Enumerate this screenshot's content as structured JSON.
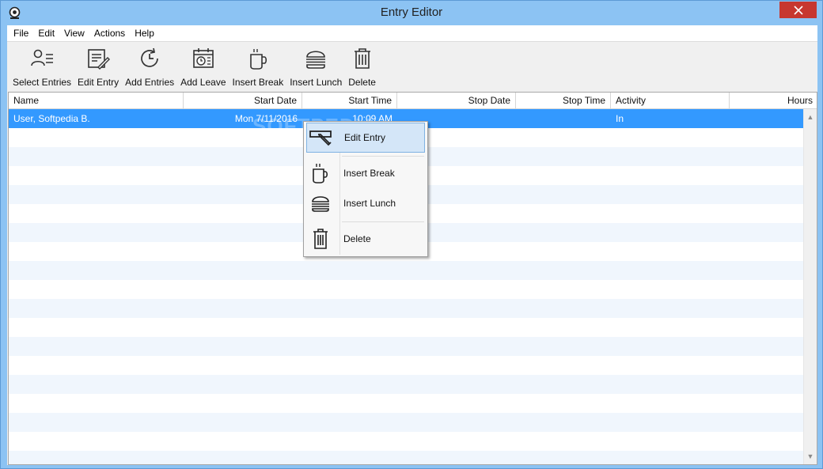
{
  "window": {
    "title": "Entry Editor"
  },
  "menubar": {
    "items": [
      "File",
      "Edit",
      "View",
      "Actions",
      "Help"
    ]
  },
  "toolbar": {
    "buttons": [
      {
        "label": "Select Entries",
        "icon": "select-entries-icon"
      },
      {
        "label": "Edit Entry",
        "icon": "edit-entry-icon"
      },
      {
        "label": "Add Entries",
        "icon": "add-entries-icon"
      },
      {
        "label": "Add Leave",
        "icon": "calendar-icon"
      },
      {
        "label": "Insert Break",
        "icon": "coffee-cup-icon"
      },
      {
        "label": "Insert Lunch",
        "icon": "burger-icon"
      },
      {
        "label": "Delete",
        "icon": "trash-icon"
      }
    ]
  },
  "grid": {
    "columns": [
      "Name",
      "Start Date",
      "Start Time",
      "Stop Date",
      "Stop Time",
      "Activity",
      "Hours"
    ],
    "rows": [
      {
        "name": "User, Softpedia B.",
        "start_date": "Mon 7/11/2016",
        "start_time": "10:09 AM",
        "stop_date": "",
        "stop_time": "",
        "activity": "In",
        "hours": ""
      }
    ]
  },
  "watermark": "SOFTPEDIA",
  "context_menu": {
    "items": [
      {
        "label": "Edit Entry",
        "icon": "edit-entry-icon"
      },
      {
        "label": "Insert Break",
        "icon": "coffee-cup-icon"
      },
      {
        "label": "Insert Lunch",
        "icon": "burger-icon"
      },
      {
        "label": "Delete",
        "icon": "trash-icon"
      }
    ]
  },
  "colors": {
    "titlebar": "#8cc3f3",
    "selection": "#3399ff",
    "close": "#c7372f",
    "menu_highlight": "#d4e6f8"
  }
}
